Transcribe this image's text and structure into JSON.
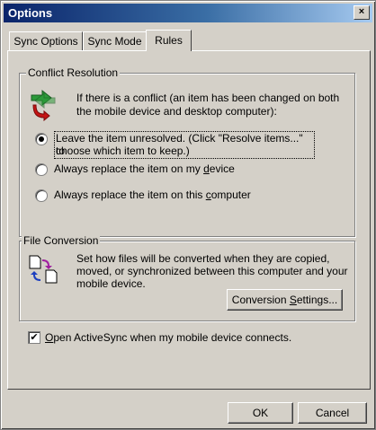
{
  "window": {
    "title": "Options",
    "close_glyph": "×"
  },
  "tabs": [
    {
      "label": "Sync Options",
      "active": false
    },
    {
      "label": "Sync Mode",
      "active": false
    },
    {
      "label": "Rules",
      "active": true
    }
  ],
  "conflict": {
    "group_label": "Conflict Resolution",
    "description_line1": "If there is a conflict (an item has been changed on both",
    "description_line2": "the mobile device and desktop computer):",
    "options": [
      {
        "line1": "Leave the item unresolved. (Click \"Resolve items...\" to",
        "line2": "choose which item to keep.)",
        "selected": true
      },
      {
        "label_before": "Always replace the item on my ",
        "accel": "d",
        "label_after": "evice",
        "selected": false
      },
      {
        "label_before": "Always replace the item on this ",
        "accel": "c",
        "label_after": "omputer",
        "selected": false
      }
    ]
  },
  "file_conversion": {
    "group_label": "File Conversion",
    "description_line1": "Set how files will be converted when they are copied,",
    "description_line2": "moved, or synchronized between this computer and your",
    "description_line3": "mobile device.",
    "button_before": "Conversion ",
    "button_accel": "S",
    "button_after": "ettings..."
  },
  "open_activesync": {
    "accel": "O",
    "label_after": "pen ActiveSync when my mobile device connects.",
    "checked": true,
    "check_glyph": "✔"
  },
  "footer": {
    "ok_label": "OK",
    "cancel_label": "Cancel"
  },
  "icons": {
    "conflict": "conflict-arrows-icon",
    "conversion": "file-conversion-icon"
  }
}
